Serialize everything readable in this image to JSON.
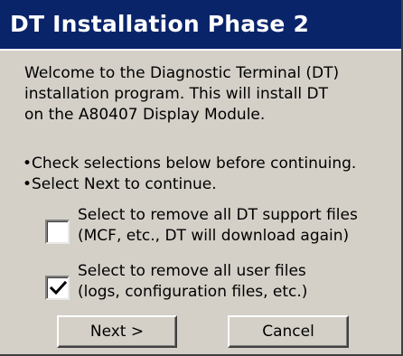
{
  "window": {
    "title": "DT Installation Phase 2"
  },
  "welcome": {
    "lines": [
      "Welcome to the Diagnostic Terminal (DT)",
      "installation program. This will install DT",
      "on the A80407 Display Module."
    ]
  },
  "instructions": {
    "items": [
      "Check selections below before continuing.",
      "Select Next to continue."
    ],
    "bullet": "•"
  },
  "options": [
    {
      "lines": [
        "Select to remove all DT support files",
        "(MCF, etc., DT will download again)"
      ],
      "checked": false
    },
    {
      "lines": [
        "Select to remove all user files",
        "(logs, configuration files, etc.)"
      ],
      "checked": true
    }
  ],
  "buttons": {
    "next_label": "Next >",
    "cancel_label": "Cancel"
  },
  "colors": {
    "title_bar": "#0a246a",
    "dialog_bg": "#d4d0c8"
  }
}
